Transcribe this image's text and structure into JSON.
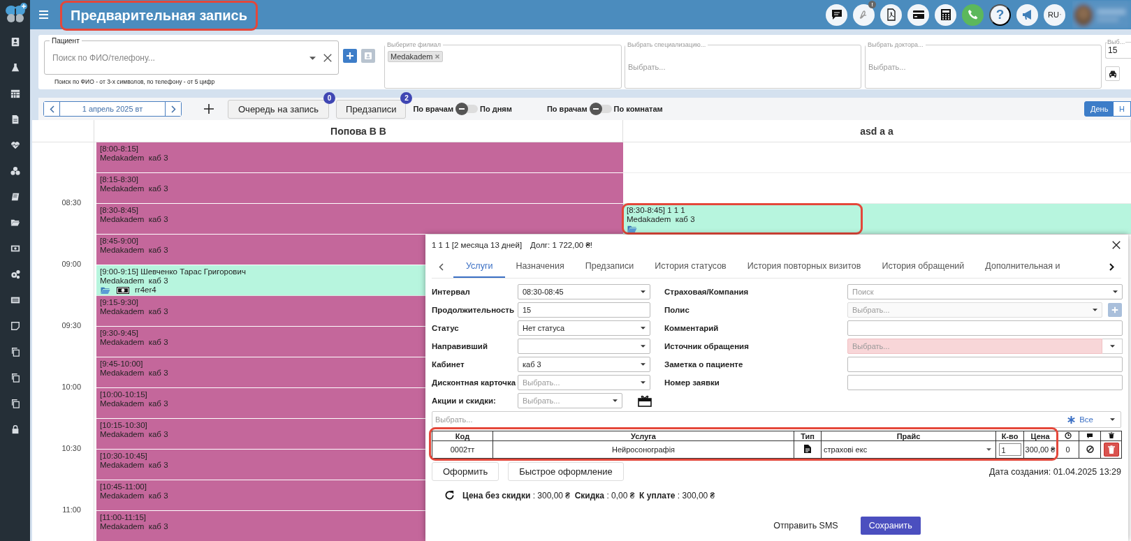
{
  "header": {
    "title": "Предварительная запись",
    "alert_badge": "!",
    "help_label": "?",
    "language": "RU"
  },
  "filters": {
    "patient": {
      "label": "Пациент",
      "placeholder": "Поиск по ФИО/телефону...",
      "hint": "Поиск по ФИО - от 3-х символов, по телефону - от 5 цифр"
    },
    "branch": {
      "label": "Выберите филиал",
      "tags": [
        "Medakadem"
      ]
    },
    "specialization": {
      "label": "Выбрать специализацию...",
      "placeholder": "Выбрать..."
    },
    "doctor": {
      "label": "Выбрать доктора...",
      "placeholder": "Выбрать..."
    },
    "interval": {
      "label": "Выб...",
      "value": "15"
    }
  },
  "toolbar": {
    "date": "1 апрель 2025 вт",
    "queue_button": {
      "label": "Очередь на запись",
      "badge": "0"
    },
    "prebook_button": {
      "label": "Предзаписи",
      "badge": "2"
    },
    "toggles": [
      {
        "left": "По врачам",
        "right": "По дням",
        "on": false
      },
      {
        "left": "По врачам",
        "right": "По комнатам",
        "on": false
      }
    ],
    "view_tabs": [
      {
        "label": "День",
        "selected": true
      },
      {
        "label": "Н",
        "selected": false
      }
    ]
  },
  "schedule": {
    "time_labels": [
      "08:30",
      "09:00",
      "09:30",
      "10:00",
      "10:30",
      "11:00"
    ],
    "columns": [
      {
        "name": "Попова В В",
        "slots": [
          {
            "kind": "blocked",
            "title": "[8:00-8:15]",
            "place": "Medakadem  каб 3"
          },
          {
            "kind": "blocked",
            "title": "[8:15-8:30]",
            "place": "Medakadem  каб 3"
          },
          {
            "kind": "blocked",
            "title": "[8:30-8:45]",
            "place": "Medakadem  каб 3"
          },
          {
            "kind": "blocked",
            "title": "[8:45-9:00]",
            "place": "Medakadem  каб 3"
          },
          {
            "kind": "appointment",
            "title": "[9:00-9:15] Шевченко Тарас Григорович",
            "place": "Medakadem  каб 3",
            "has_folder": true,
            "has_payment": true,
            "note": "rr4er4"
          },
          {
            "kind": "blocked",
            "title": "[9:15-9:30]",
            "place": "Medakadem  каб 3"
          },
          {
            "kind": "blocked",
            "title": "[9:30-9:45]",
            "place": "Medakadem  каб 3"
          },
          {
            "kind": "blocked",
            "title": "[9:45-10:00]",
            "place": "Medakadem  каб 3"
          },
          {
            "kind": "blocked",
            "title": "[10:00-10:15]",
            "place": "Medakadem  каб 3"
          },
          {
            "kind": "blocked",
            "title": "[10:15-10:30]",
            "place": "Medakadem  каб 3"
          },
          {
            "kind": "blocked",
            "title": "[10:30-10:45]",
            "place": "Medakadem  каб 3"
          },
          {
            "kind": "blocked",
            "title": "[10:45-11:00]",
            "place": "Medakadem  каб 3"
          },
          {
            "kind": "blocked",
            "title": "[11:00-11:15]",
            "place": "Medakadem  каб 3"
          }
        ]
      },
      {
        "name": "asd a a",
        "slots": [
          {
            "kind": "empty"
          },
          {
            "kind": "empty"
          },
          {
            "kind": "appointment",
            "title": "[8:30-8:45] 1 1 1",
            "place": "Medakadem  каб 3",
            "has_folder": true,
            "has_payment": false
          }
        ]
      }
    ]
  },
  "appointment_dialog": {
    "title": "1 1 1 [2 месяца 13 дней]",
    "debt": "Долг: 1 722,00 ₴!",
    "tabs": [
      {
        "label": "Услуги",
        "selected": true
      },
      {
        "label": "Назначения",
        "selected": false
      },
      {
        "label": "Предзаписи",
        "selected": false
      },
      {
        "label": "История статусов",
        "selected": false
      },
      {
        "label": "История повторных визитов",
        "selected": false
      },
      {
        "label": "История обращений",
        "selected": false
      },
      {
        "label": "Дополнительная и",
        "selected": false
      }
    ],
    "left_fields": [
      {
        "label": "Интервал",
        "kind": "select",
        "value": "08:30-08:45"
      },
      {
        "label": "Продолжительность",
        "kind": "input",
        "value": "15"
      },
      {
        "label": "Статус",
        "kind": "select",
        "value": "Нет статуса"
      },
      {
        "label": "Направивший",
        "kind": "select"
      },
      {
        "label": "Кабинет",
        "kind": "select",
        "value": "каб 3"
      },
      {
        "label": "Дисконтная карточка",
        "kind": "select",
        "placeholder": "Выбрать..."
      },
      {
        "label": "Акции и скидки:",
        "kind": "promo",
        "placeholder": "Выбрать..."
      }
    ],
    "right_fields": [
      {
        "label": "Страховая/Компания",
        "kind": "select",
        "placeholder": "Поиск",
        "disabled": false,
        "invalid": false
      },
      {
        "label": "Полис",
        "kind": "select_add",
        "placeholder": "Выбрать...",
        "disabled": true,
        "invalid": false
      },
      {
        "label": "Комментарий",
        "kind": "input",
        "disabled": false,
        "invalid": false
      },
      {
        "label": "Источник обращения",
        "kind": "select",
        "placeholder": "Выбрать...",
        "disabled": false,
        "invalid": true
      },
      {
        "label": "Заметка о пациенте",
        "kind": "input",
        "disabled": false,
        "invalid": false
      },
      {
        "label": "Номер заявки",
        "kind": "input",
        "disabled": false,
        "invalid": false
      }
    ],
    "service_search": {
      "placeholder": "Выбрать...",
      "filter": "Все"
    },
    "services_table": {
      "columns": [
        "Код",
        "Услуга",
        "Тип",
        "Прайс",
        "К-во",
        "Цена"
      ],
      "rows": [
        {
          "code": "0002тт",
          "name": "Нейросонографія",
          "price_list": "страхові екс",
          "quantity": "1",
          "price": "300,00 ₴",
          "count": "0"
        }
      ]
    },
    "actions": [
      "Оформить",
      "Быстрое оформление"
    ],
    "created": "Дата создания: 01.04.2025 13:29",
    "totals": "**Цена без скидки** : 300,00 ₴  **Скидка** : 0,00 ₴  **К уплате** : 300,00 ₴",
    "footer_buttons": [
      {
        "label": "Отправить SMS",
        "kind": "link"
      },
      {
        "label": "Сохранить",
        "kind": "primary"
      }
    ]
  }
}
